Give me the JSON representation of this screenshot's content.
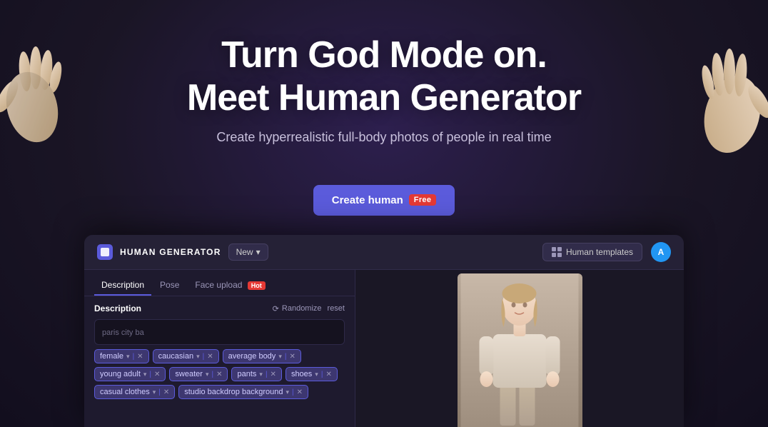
{
  "background": {
    "color": "#1a1525"
  },
  "hero": {
    "title_line1": "Turn God Mode on.",
    "title_line2": "Meet Human Generator",
    "subtitle": "Create hyperrealistic full-body photos of people in real time",
    "cta_label": "Create human",
    "cta_badge": "Free"
  },
  "app": {
    "brand": "HUMAN GENERATOR",
    "new_button": "New",
    "human_templates_btn": "Human templates",
    "avatar_letter": "A",
    "tabs": [
      {
        "label": "Description",
        "active": true
      },
      {
        "label": "Pose",
        "active": false
      },
      {
        "label": "Face upload",
        "active": false,
        "badge": "Hot"
      }
    ],
    "description_section": {
      "label": "Description",
      "randomize_label": "Randomize",
      "reset_label": "reset",
      "placeholder": "paris city ba"
    },
    "tags": [
      {
        "text": "female",
        "has_chevron": true,
        "has_pipe": true,
        "has_x": true
      },
      {
        "text": "caucasian",
        "has_chevron": true,
        "has_pipe": true,
        "has_x": true
      },
      {
        "text": "average body",
        "has_chevron": true,
        "has_pipe": true,
        "has_x": true
      },
      {
        "text": "young adult",
        "has_chevron": true,
        "has_pipe": true,
        "has_x": true
      },
      {
        "text": "sweater",
        "has_chevron": true,
        "has_pipe": true,
        "has_x": true
      },
      {
        "text": "pants",
        "has_chevron": true,
        "has_pipe": true,
        "has_x": true
      },
      {
        "text": "shoes",
        "has_chevron": true,
        "has_pipe": true,
        "has_x": true
      },
      {
        "text": "casual clothes",
        "has_chevron": true,
        "has_pipe": true,
        "has_x": true
      },
      {
        "text": "studio backdrop background",
        "has_chevron": true,
        "has_pipe": true,
        "has_x": true
      }
    ]
  }
}
